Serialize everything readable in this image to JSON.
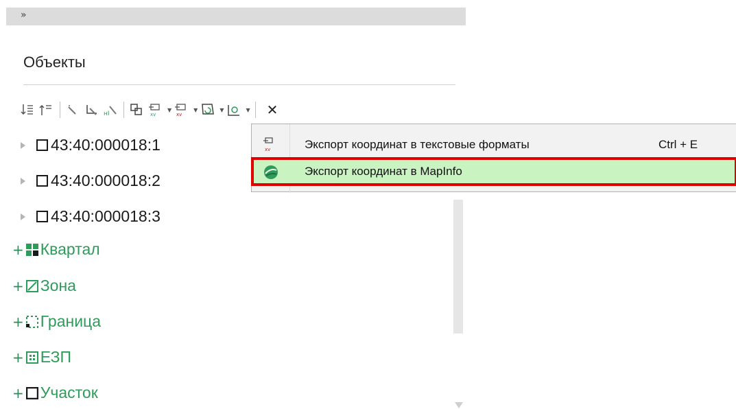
{
  "panel": {
    "collapse_glyph": "»",
    "title": "Объекты",
    "toolbar": {
      "icons": [
        "sort-asc-icon",
        "sort-desc-icon",
        "wand-icon",
        "tree-select-icon",
        "hierarchy-select-icon",
        "copy-icon",
        "export-text-icon",
        "export-xv-icon",
        "polygon-icon",
        "geo-edit-icon",
        "close-icon"
      ],
      "close_glyph": "✕"
    },
    "tree": {
      "items": [
        {
          "label": "43:40:000018:1"
        },
        {
          "label": "43:40:000018:2"
        },
        {
          "label": "43:40:000018:3"
        }
      ],
      "categories": [
        {
          "label": "Квартал",
          "icon": "quarter-grid-icon"
        },
        {
          "label": "Зона",
          "icon": "zone-icon"
        },
        {
          "label": "Граница",
          "icon": "border-icon"
        },
        {
          "label": "ЕЗП",
          "icon": "ezp-icon"
        },
        {
          "label": "Участок",
          "icon": "parcel-icon"
        }
      ],
      "plus": "+"
    }
  },
  "menu": {
    "items": [
      {
        "label": "Экспорт координат в текстовые форматы",
        "shortcut": "Ctrl + E",
        "icon": "export-xv-icon"
      },
      {
        "label": "Экспорт координат в MapInfo",
        "shortcut": "",
        "icon": "mapinfo-icon"
      }
    ]
  },
  "colors": {
    "accent_green": "#2e9b5a",
    "highlight_bg": "#c9f3c1",
    "highlight_border": "#e00000"
  }
}
